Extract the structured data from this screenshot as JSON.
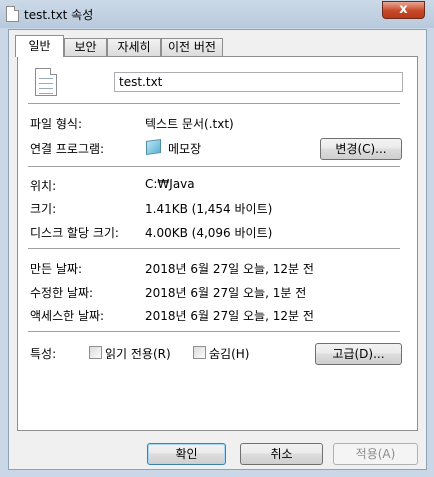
{
  "window": {
    "title": "test.txt 속성",
    "close_glyph": "x"
  },
  "tabs": [
    "일반",
    "보안",
    "자세히",
    "이전 버전"
  ],
  "general": {
    "filename": "test.txt",
    "file_type_label": "파일 형식:",
    "file_type_value": "텍스트 문서(.txt)",
    "opens_with_label": "연결 프로그램:",
    "opens_with_value": "메모장",
    "change_button": "변경(C)...",
    "location_label": "위치:",
    "location_value": "C:₩Java",
    "size_label": "크기:",
    "size_value": "1.41KB (1,454 바이트)",
    "size_on_disk_label": "디스크 할당 크기:",
    "size_on_disk_value": "4.00KB (4,096 바이트)",
    "created_label": "만든 날짜:",
    "created_value": "2018년 6월 27일 오늘, 12분 전",
    "modified_label": "수정한 날짜:",
    "modified_value": "2018년 6월 27일 오늘, 1분 전",
    "accessed_label": "액세스한 날짜:",
    "accessed_value": "2018년 6월 27일 오늘, 12분 전",
    "attributes_label": "특성:",
    "readonly_label": "읽기 전용(R)",
    "readonly_checked": false,
    "hidden_label": "숨김(H)",
    "hidden_checked": false,
    "advanced_button": "고급(D)..."
  },
  "buttons": {
    "ok": "확인",
    "cancel": "취소",
    "apply": "적용(A)"
  }
}
